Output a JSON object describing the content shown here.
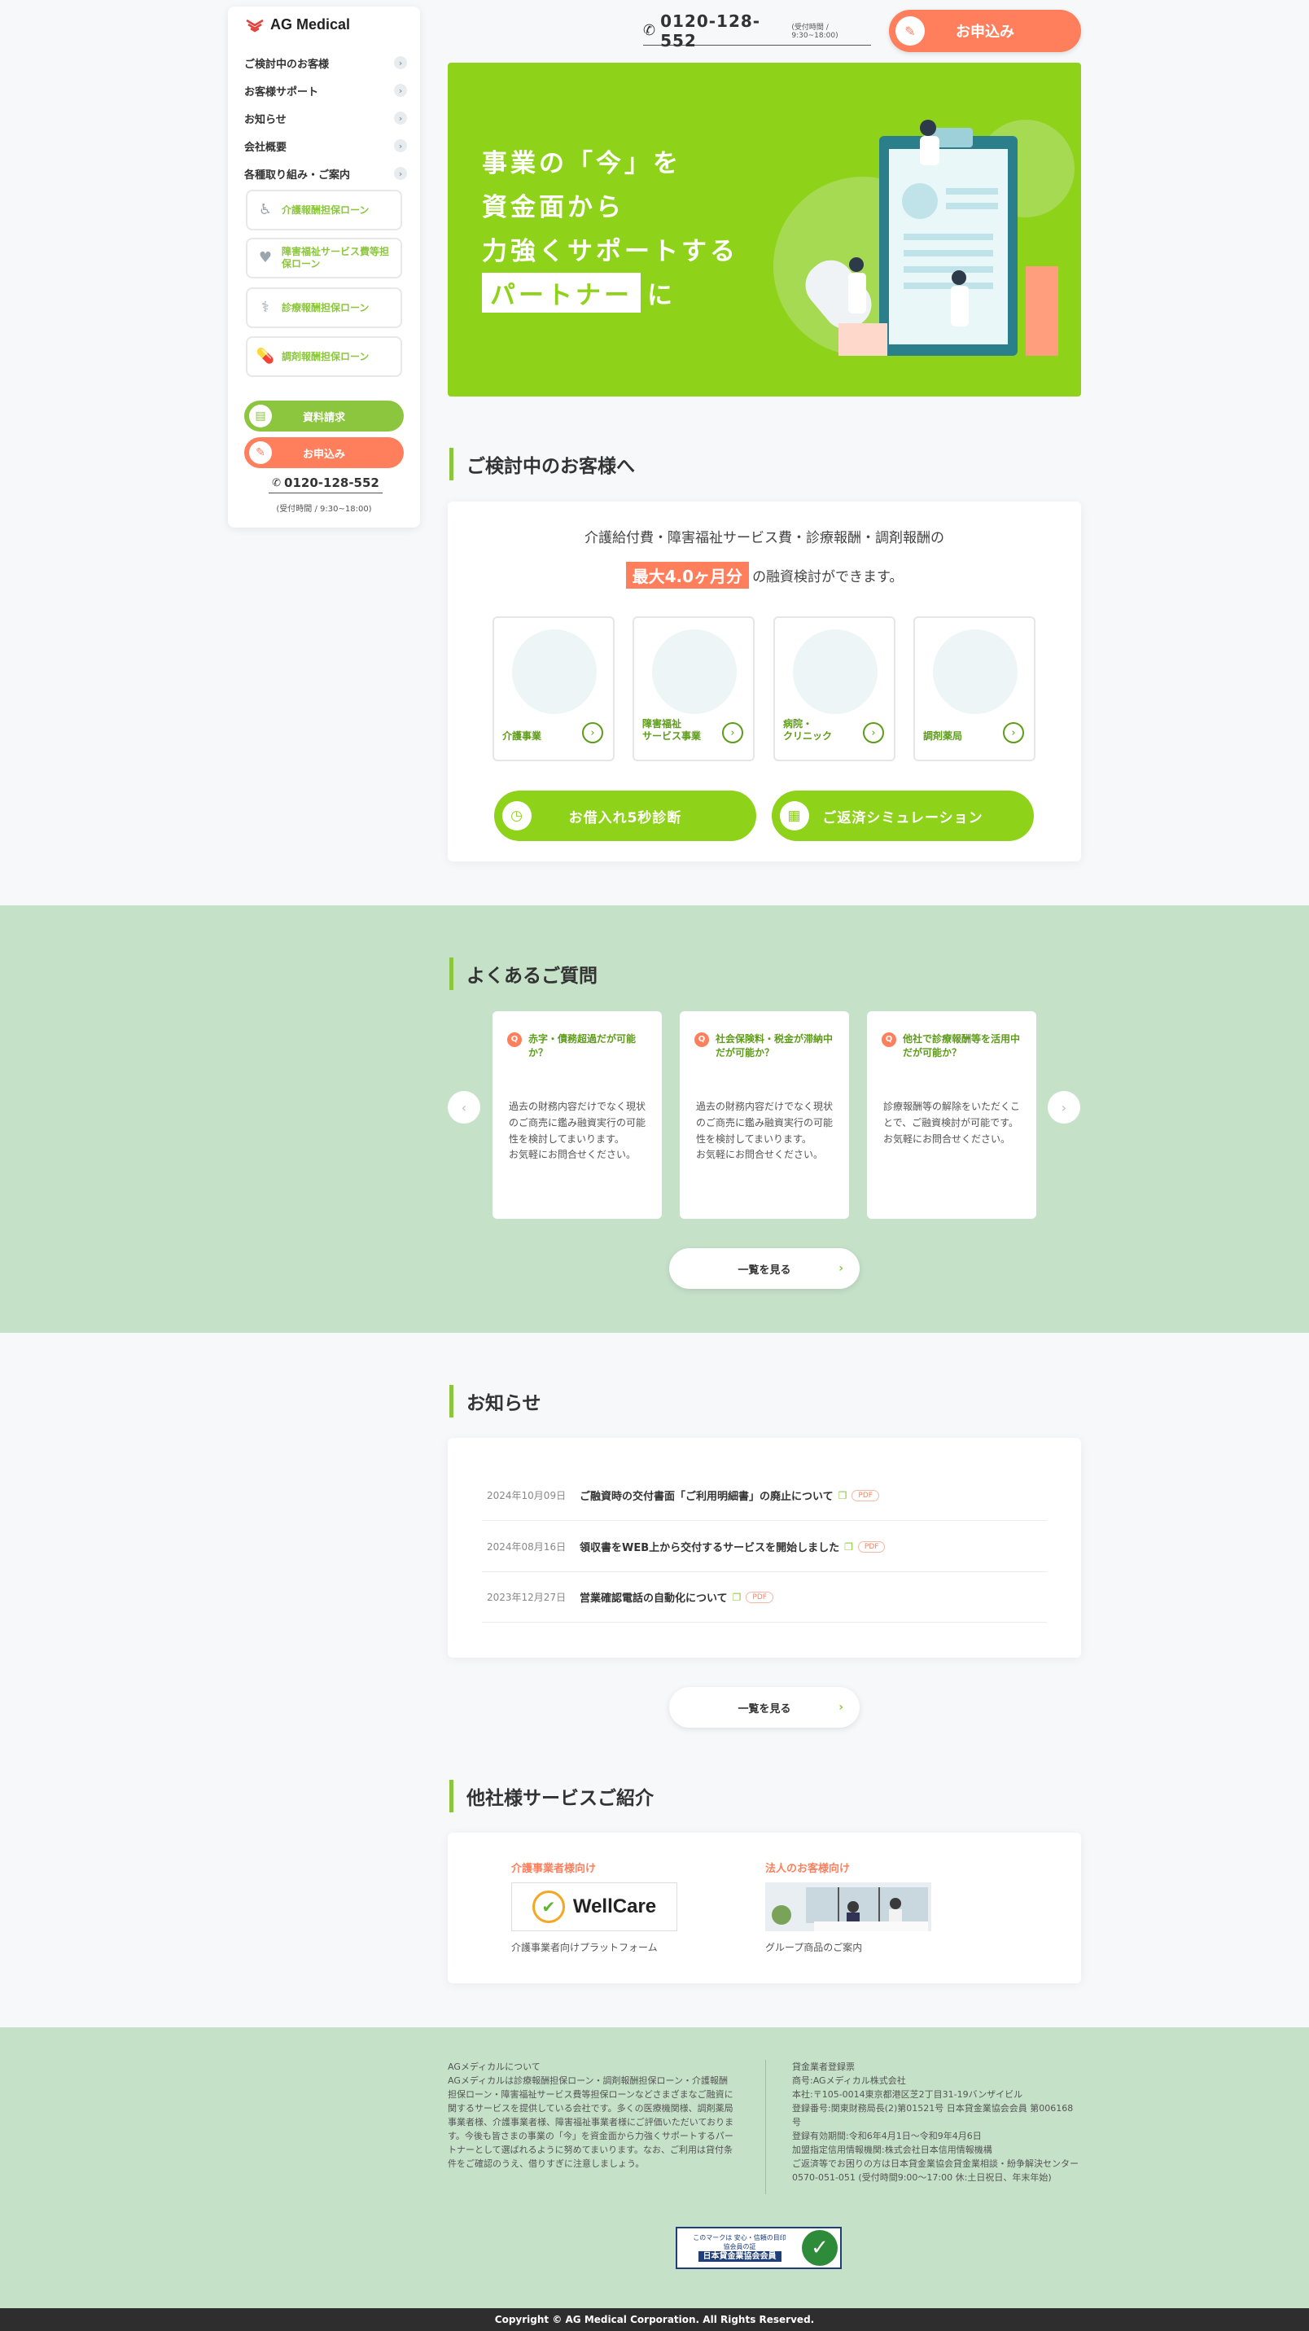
{
  "brand": {
    "name": "AG Medical"
  },
  "sidebar": {
    "nav": [
      {
        "label": "ご検討中のお客様"
      },
      {
        "label": "お客様サポート"
      },
      {
        "label": "お知らせ"
      },
      {
        "label": "会社概要"
      },
      {
        "label": "各種取り組み・ご案内"
      }
    ],
    "loans": [
      {
        "label": "介護報酬担保ローン",
        "icon": "wheelchair-icon"
      },
      {
        "label": "障害福祉サービス費等担保ローン",
        "icon": "heart-hand-icon"
      },
      {
        "label": "診療報酬担保ローン",
        "icon": "stethoscope-icon"
      },
      {
        "label": "調剤報酬担保ローン",
        "icon": "pill-icon"
      }
    ],
    "request_label": "資料請求",
    "apply_label": "お申込み",
    "phone": "0120-128-552",
    "hours": "(受付時間 / 9:30~18:00)"
  },
  "header": {
    "phone": "0120-128-552",
    "hours": "(受付時間 / 9:30~18:00)",
    "apply_label": "お申込み"
  },
  "hero": {
    "line1": "事業の「今」を",
    "line2": "資金面から",
    "line3": "力強くサポートする",
    "highlight": "パートナー",
    "suffix": "に"
  },
  "consider": {
    "title": "ご検討中のお客様へ",
    "lead": "介護給付費・障害福祉サービス費・診療報酬・調剤報酬の",
    "highlight": "最大4.0ヶ月分",
    "lead_suffix": "の融資検討ができます。",
    "categories": [
      {
        "label1": "介護事業",
        "label2": ""
      },
      {
        "label1": "障害福祉",
        "label2": "サービス事業"
      },
      {
        "label1": "病院・",
        "label2": "クリニック"
      },
      {
        "label1": "調剤薬局",
        "label2": ""
      }
    ],
    "diagnosis_label": "お借入れ5秒診断",
    "simulation_label": "ご返済シミュレーション"
  },
  "faq": {
    "title": "よくあるご質問",
    "items": [
      {
        "q": "赤字・債務超過だが可能か？",
        "a": "過去の財務内容だけでなく現状のご商売に鑑み融資実行の可能性を検討してまいります。\nお気軽にお問合せください。"
      },
      {
        "q": "社会保険料・税金が滞納中だが可能か？",
        "a": "過去の財務内容だけでなく現状のご商売に鑑み融資実行の可能性を検討してまいります。\nお気軽にお問合せください。"
      },
      {
        "q": "他社で診療報酬等を活用中だが可能か？",
        "a": "診療報酬等の解除をいただくことで、ご融資検討が可能です。\nお気軽にお問合せください。"
      }
    ],
    "more_label": "一覧を見る"
  },
  "news": {
    "title": "お知らせ",
    "items": [
      {
        "date": "2024年10月09日",
        "title": "ご融資時の交付書面「ご利用明細書」の廃止について",
        "pdf": "PDF"
      },
      {
        "date": "2024年08月16日",
        "title": "領収書をWEB上から交付するサービスを開始しました",
        "pdf": "PDF"
      },
      {
        "date": "2023年12月27日",
        "title": "営業確認電話の自動化について",
        "pdf": "PDF"
      }
    ],
    "more_label": "一覧を見る"
  },
  "services": {
    "title": "他社様サービスご紹介",
    "items": [
      {
        "label": "介護事業者様向け",
        "logo": "WellCare",
        "desc": "介護事業者向けプラットフォーム"
      },
      {
        "label": "法人のお客様向け",
        "logo": "",
        "desc": "グループ商品のご案内"
      }
    ]
  },
  "footer": {
    "about_title": "AGメディカルについて",
    "about_text": "AGメディカルは診療報酬担保ローン・調剤報酬担保ローン・介護報酬担保ローン・障害福祉サービス費等担保ローンなどさまざまなご融資に関するサービスを提供している会社です。多くの医療機関様、調剤薬局事業者様、介護事業者様、障害福祉事業者様にご評価いただいております。今後も皆さまの事業の「今」を資金面から力強くサポートするパートナーとして選ばれるように努めてまいります。なお、ご利用は貸付条件をご確認のうえ、借りすぎに注意しましょう。",
    "reg_title": "貸金業者登録票",
    "reg_lines": [
      "商号:AGメディカル株式会社",
      "本社:〒105-0014東京都港区芝2丁目31-19バンザイビル",
      "登録番号:関東財務局長(2)第01521号 日本貸金業協会会員 第006168号",
      "登録有効期間:令和6年4月1日～令和9年4月6日",
      "加盟指定信用情報機関:株式会社日本信用情報機構",
      "ご返済等でお困りの方は日本貸金業協会貸金業相談・紛争解決センター",
      "0570-051-051 (受付時間9:00～17:00 休:土日祝日、年末年始)"
    ],
    "badge_line1": "このマークは 安心・信頼の目印",
    "badge_line2": "協会員の証",
    "badge_line3": "日本貸金業協会会員",
    "copyright": "Copyright © AG Medical Corporation. All Rights Reserved."
  }
}
